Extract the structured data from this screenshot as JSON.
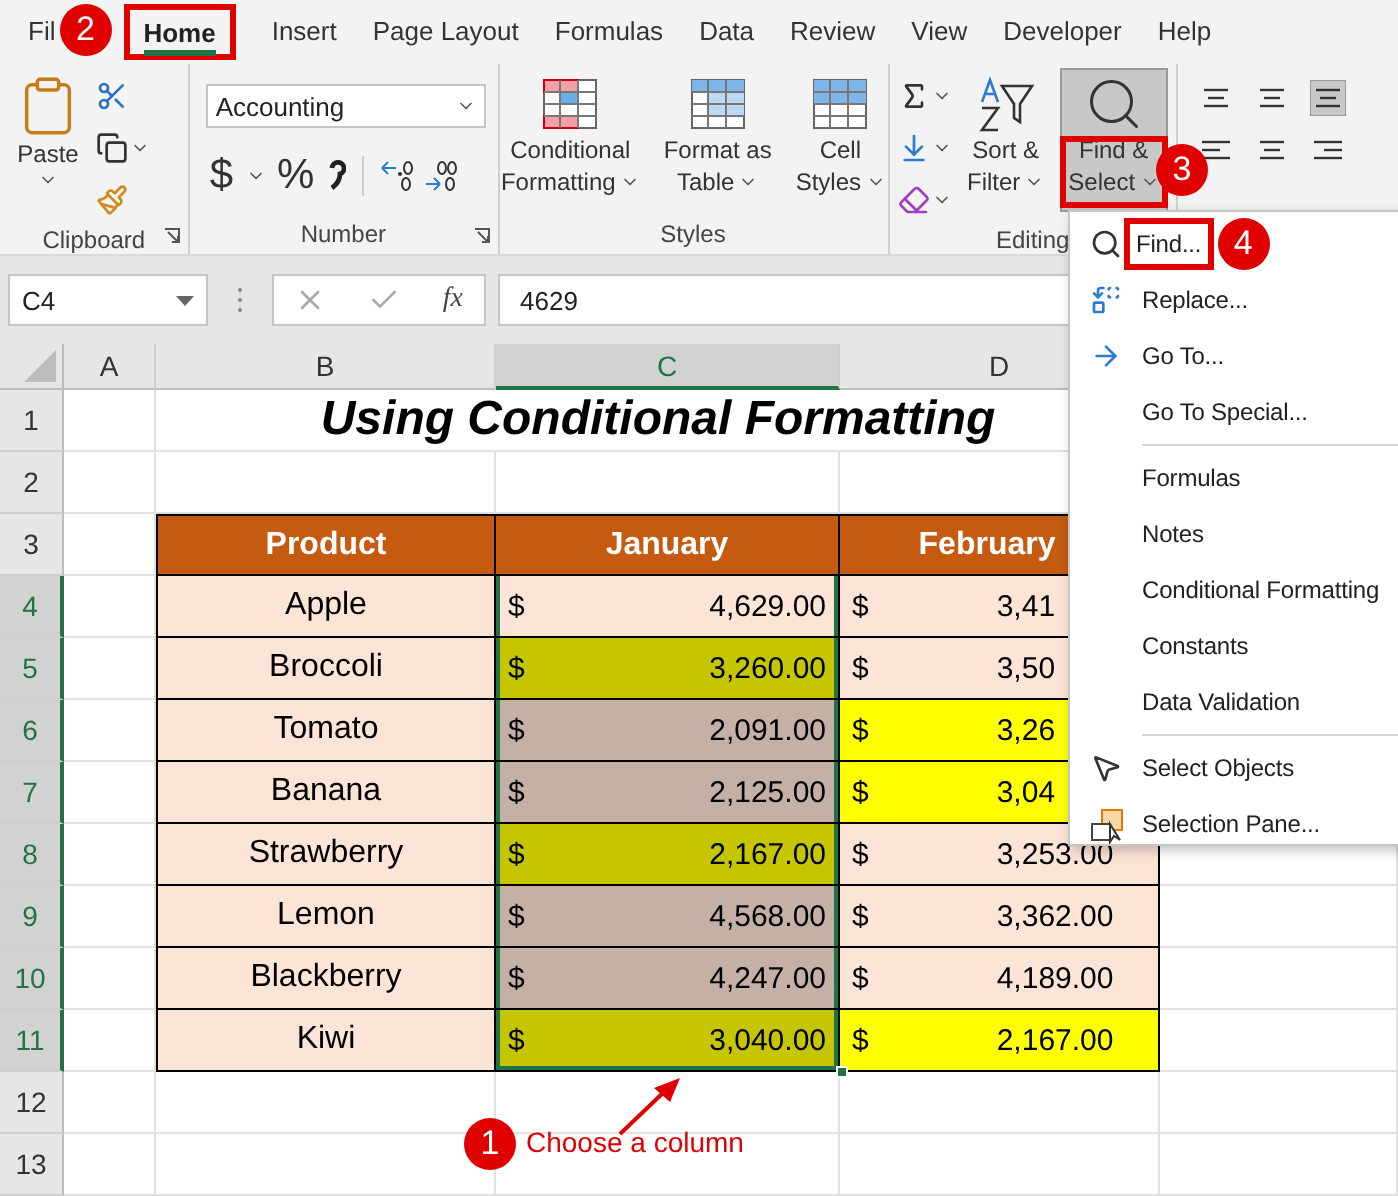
{
  "ribbon_tabs": [
    {
      "label": "Fil",
      "selected": false
    },
    {
      "label": "Home",
      "selected": true
    },
    {
      "label": "Insert",
      "selected": false
    },
    {
      "label": "Page Layout",
      "selected": false
    },
    {
      "label": "Formulas",
      "selected": false
    },
    {
      "label": "Data",
      "selected": false
    },
    {
      "label": "Review",
      "selected": false
    },
    {
      "label": "View",
      "selected": false
    },
    {
      "label": "Developer",
      "selected": false
    },
    {
      "label": "Help",
      "selected": false
    }
  ],
  "ribbon": {
    "clipboard": {
      "paste": "Paste",
      "label": "Clipboard"
    },
    "number": {
      "format": "Accounting",
      "currency": "$",
      "percent": "%",
      "label": "Number"
    },
    "styles": {
      "buttons": [
        [
          "Conditional",
          "Formatting"
        ],
        [
          "Format as",
          "Table"
        ],
        [
          "Cell",
          "Styles"
        ]
      ],
      "label": "Styles"
    },
    "editing": {
      "sort": [
        "Sort &",
        "Filter"
      ],
      "find": [
        "Find &",
        "Select"
      ],
      "find_pressed": true,
      "label": "Editing"
    }
  },
  "formula_bar": {
    "name_box": "C4",
    "function_label": "fx",
    "formula": "4629"
  },
  "columns": [
    {
      "label": "A",
      "selected": false
    },
    {
      "label": "B",
      "selected": false
    },
    {
      "label": "C",
      "selected": true
    },
    {
      "label": "D",
      "selected": false
    }
  ],
  "rows": [
    {
      "label": "1",
      "selected": false
    },
    {
      "label": "2",
      "selected": false
    },
    {
      "label": "3",
      "selected": false
    },
    {
      "label": "4",
      "selected": true
    },
    {
      "label": "5",
      "selected": true
    },
    {
      "label": "6",
      "selected": true
    },
    {
      "label": "7",
      "selected": true
    },
    {
      "label": "8",
      "selected": true
    },
    {
      "label": "9",
      "selected": true
    },
    {
      "label": "10",
      "selected": true
    },
    {
      "label": "11",
      "selected": true
    },
    {
      "label": "12",
      "selected": false
    },
    {
      "label": "13",
      "selected": false
    }
  ],
  "title": "Using Conditional Formatting",
  "table": {
    "headers": [
      "Product",
      "January",
      "February"
    ],
    "rows": [
      {
        "product": "Apple",
        "january": {
          "currency": "$",
          "value": "4,629.00",
          "color": "#fce4d6"
        },
        "february": {
          "currency": "$",
          "value": "3,41",
          "color": "#fce4d6"
        }
      },
      {
        "product": "Broccoli",
        "january": {
          "currency": "$",
          "value": "3,260.00",
          "color": "#c6c600"
        },
        "february": {
          "currency": "$",
          "value": "3,50",
          "color": "#fce4d6"
        }
      },
      {
        "product": "Tomato",
        "january": {
          "currency": "$",
          "value": "2,091.00",
          "color": "#c4b0a4"
        },
        "february": {
          "currency": "$",
          "value": "3,26",
          "color": "#ffff00"
        }
      },
      {
        "product": "Banana",
        "january": {
          "currency": "$",
          "value": "2,125.00",
          "color": "#c4b0a4"
        },
        "february": {
          "currency": "$",
          "value": "3,04",
          "color": "#ffff00"
        }
      },
      {
        "product": "Strawberry",
        "january": {
          "currency": "$",
          "value": "2,167.00",
          "color": "#c6c600"
        },
        "february": {
          "currency": "$",
          "value": "3,253.00",
          "color": "#fce4d6"
        }
      },
      {
        "product": "Lemon",
        "january": {
          "currency": "$",
          "value": "4,568.00",
          "color": "#c4b0a4"
        },
        "february": {
          "currency": "$",
          "value": "3,362.00",
          "color": "#fce4d6"
        }
      },
      {
        "product": "Blackberry",
        "january": {
          "currency": "$",
          "value": "4,247.00",
          "color": "#c4b0a4"
        },
        "february": {
          "currency": "$",
          "value": "4,189.00",
          "color": "#fce4d6"
        }
      },
      {
        "product": "Kiwi",
        "january": {
          "currency": "$",
          "value": "3,040.00",
          "color": "#c6c600"
        },
        "february": {
          "currency": "$",
          "value": "2,167.00",
          "color": "#ffff00"
        }
      }
    ]
  },
  "find_menu": {
    "groups": [
      [
        {
          "label": "Find..."
        },
        {
          "label": "Replace..."
        },
        {
          "label": "Go To..."
        },
        {
          "label": "Go To Special..."
        }
      ],
      [
        {
          "label": "Formulas"
        },
        {
          "label": "Notes"
        },
        {
          "label": "Conditional Formatting"
        },
        {
          "label": "Constants"
        },
        {
          "label": "Data Validation"
        }
      ],
      [
        {
          "label": "Select Objects"
        },
        {
          "label": "Selection Pane..."
        }
      ]
    ]
  },
  "annotations": {
    "badges": [
      "1",
      "2",
      "3",
      "4"
    ],
    "caption": "Choose a column"
  }
}
